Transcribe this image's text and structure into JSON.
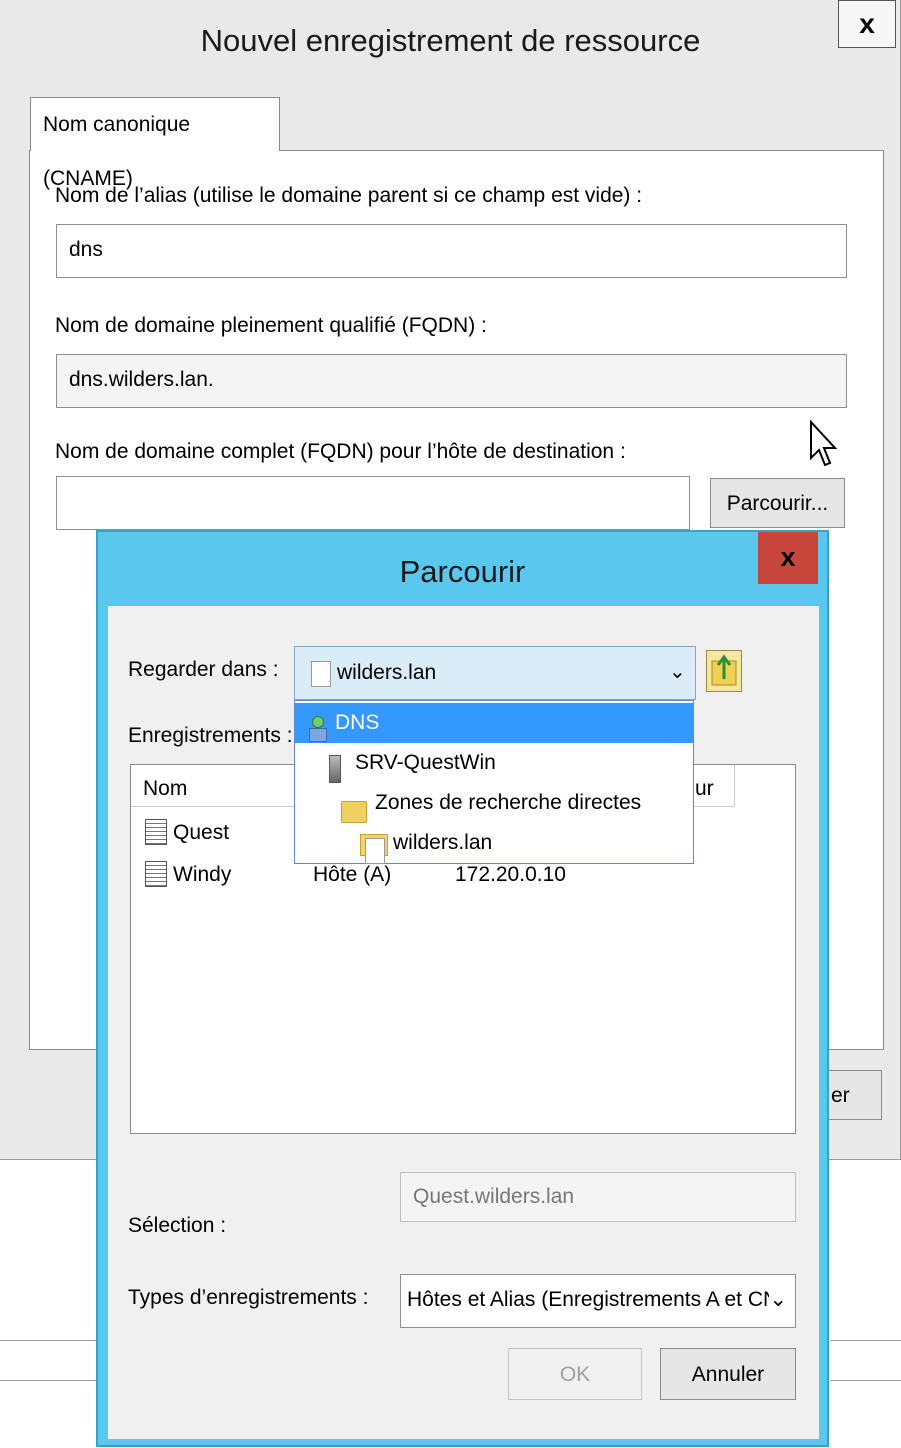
{
  "bg_dialog": {
    "title": "Nouvel enregistrement de ressource",
    "close_label": "x",
    "tab_label": "Nom canonique (CNAME)",
    "alias_label": "Nom de l’alias (utilise le domaine parent si ce champ est vide) :",
    "alias_value": "dns",
    "fqdn_label": "Nom de domaine pleinement qualifié (FQDN) :",
    "fqdn_value": "dns.wilders.lan.",
    "target_label": "Nom de domaine complet (FQDN) pour l’hôte de destination :",
    "target_value": "",
    "browse_button": "Parcourir...",
    "partial_button": "er"
  },
  "browse_dialog": {
    "title": "Parcourir",
    "close_label": "x",
    "look_in_label": "Regarder dans :",
    "look_in_value": "wilders.lan",
    "records_label": "Enregistrements :",
    "dropdown_items": [
      {
        "label": "DNS",
        "icon": "dns-icon",
        "selected": true
      },
      {
        "label": "SRV-QuestWin",
        "icon": "server-icon",
        "selected": false
      },
      {
        "label": "Zones de recherche directes",
        "icon": "folder-icon",
        "selected": false
      },
      {
        "label": "wilders.lan",
        "icon": "zone-icon",
        "selected": false
      }
    ],
    "columns": [
      "Nom",
      "",
      "ur"
    ],
    "records": [
      {
        "name": "Quest",
        "type": "",
        "data": ""
      },
      {
        "name": "Windy",
        "type": "Hôte (A)",
        "data": "172.20.0.10"
      }
    ],
    "selection_label": "Sélection :",
    "selection_value": "Quest.wilders.lan",
    "types_label": "Types d’enregistrements :",
    "types_value": "Hôtes et Alias (Enregistrements A et CN",
    "ok_button": "OK",
    "cancel_button": "Annuler"
  },
  "colors": {
    "accent": "#5ac8ee",
    "close_red": "#c8453c",
    "selection_blue": "#3399ff"
  }
}
